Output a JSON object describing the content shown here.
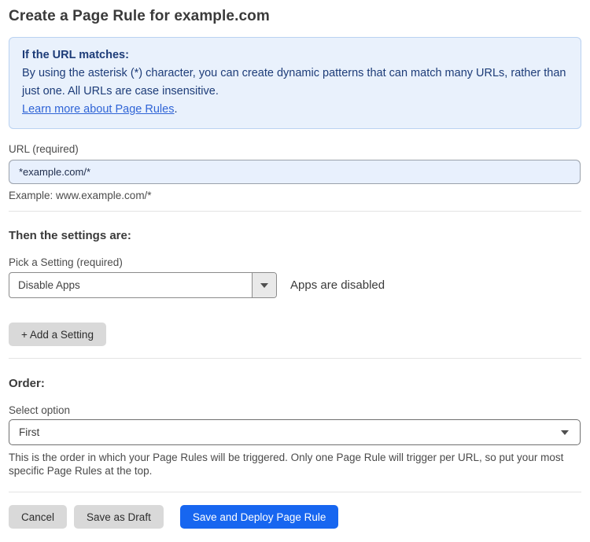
{
  "page": {
    "title": "Create a Page Rule for example.com"
  },
  "info_box": {
    "heading": "If the URL matches:",
    "body": "By using the asterisk (*) character, you can create dynamic patterns that can match many URLs, rather than just one. All URLs are case insensitive.",
    "link_label": "Learn more about Page Rules",
    "link_suffix": "."
  },
  "url_field": {
    "label": "URL (required)",
    "value": "*example.com/*",
    "example": "Example: www.example.com/*"
  },
  "settings_section": {
    "heading": "Then the settings are:",
    "picker_label": "Pick a Setting (required)",
    "selected_setting": "Disable Apps",
    "status_text": "Apps are disabled",
    "add_setting_label": "+ Add a Setting"
  },
  "order_section": {
    "heading": "Order:",
    "select_label": "Select option",
    "selected_option": "First",
    "help_text": "This is the order in which your Page Rules will be triggered. Only one Page Rule will trigger per URL, so put your most specific Page Rules at the top."
  },
  "footer": {
    "cancel_label": "Cancel",
    "save_draft_label": "Save as Draft",
    "save_deploy_label": "Save and Deploy Page Rule"
  },
  "icons": {
    "dropdown_caret": "caret-down"
  },
  "colors": {
    "info_box_bg": "#e9f1fc",
    "info_box_border": "#bad2f1",
    "info_text": "#1d3c78",
    "link": "#2f64d6",
    "url_input_bg": "#e8f0fd",
    "primary_button_bg": "#1766f0",
    "gray_button_bg": "#d9d9d9"
  }
}
